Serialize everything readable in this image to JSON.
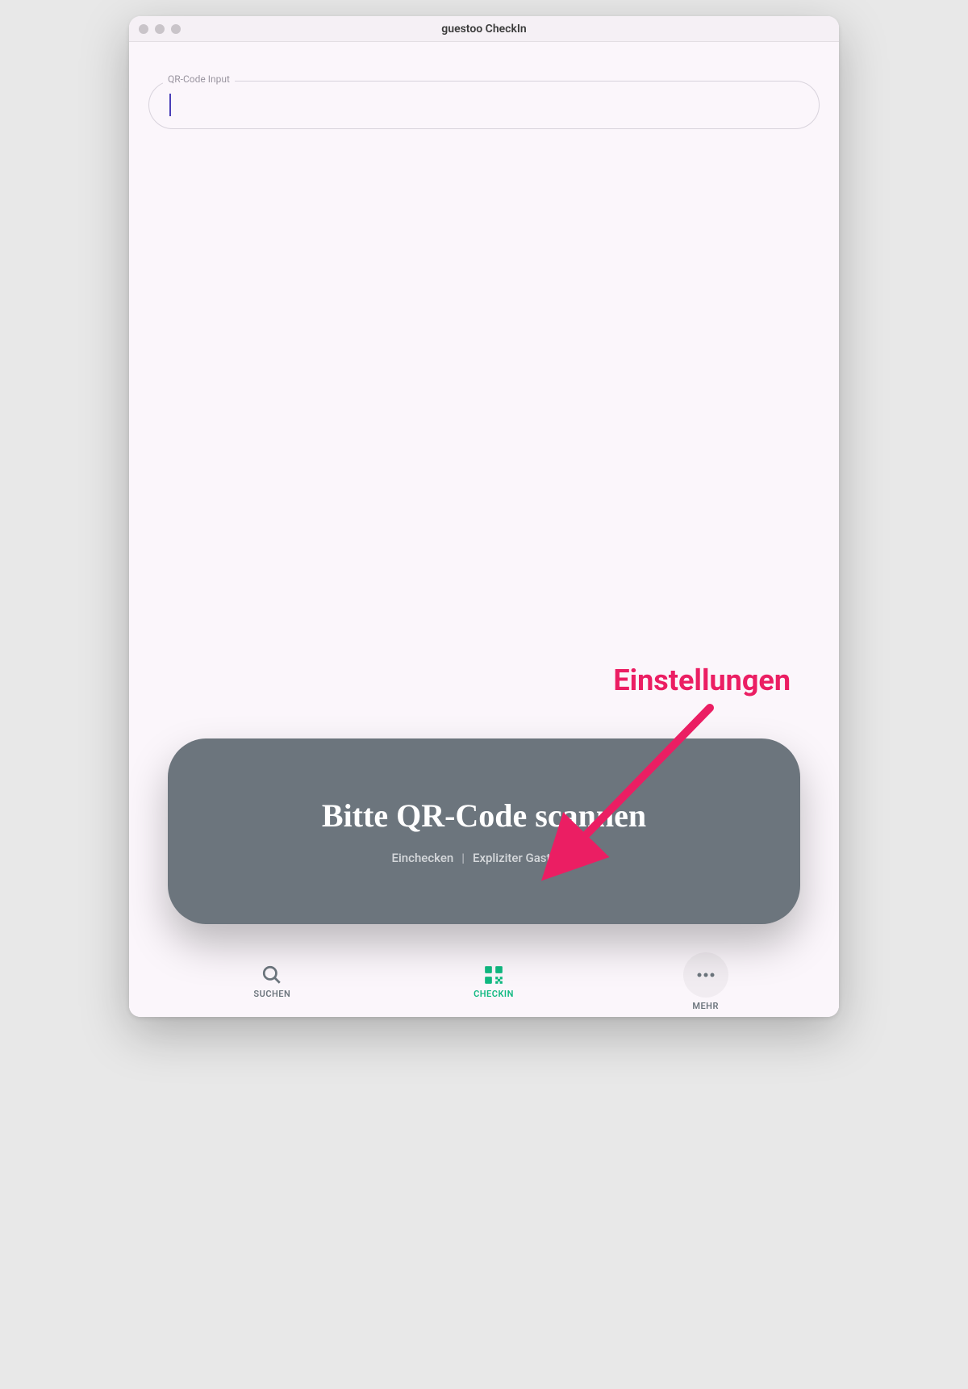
{
  "window": {
    "title": "guestoo CheckIn"
  },
  "input": {
    "label": "QR-Code Input",
    "value": ""
  },
  "annotation": {
    "label": "Einstellungen"
  },
  "scan_card": {
    "title": "Bitte QR-Code scannen",
    "mode1": "Einchecken",
    "separator": "|",
    "mode2": "Expliziter Gast"
  },
  "nav": {
    "items": [
      {
        "label": "SUCHEN",
        "icon": "search",
        "active": false
      },
      {
        "label": "CHECKIN",
        "icon": "qr",
        "active": true
      },
      {
        "label": "MEHR",
        "icon": "more",
        "active": false
      }
    ]
  },
  "colors": {
    "accent_green": "#10b981",
    "annotation_pink": "#eb1e63",
    "card_gray": "#6c757d",
    "caret_purple": "#4a3fb8"
  }
}
